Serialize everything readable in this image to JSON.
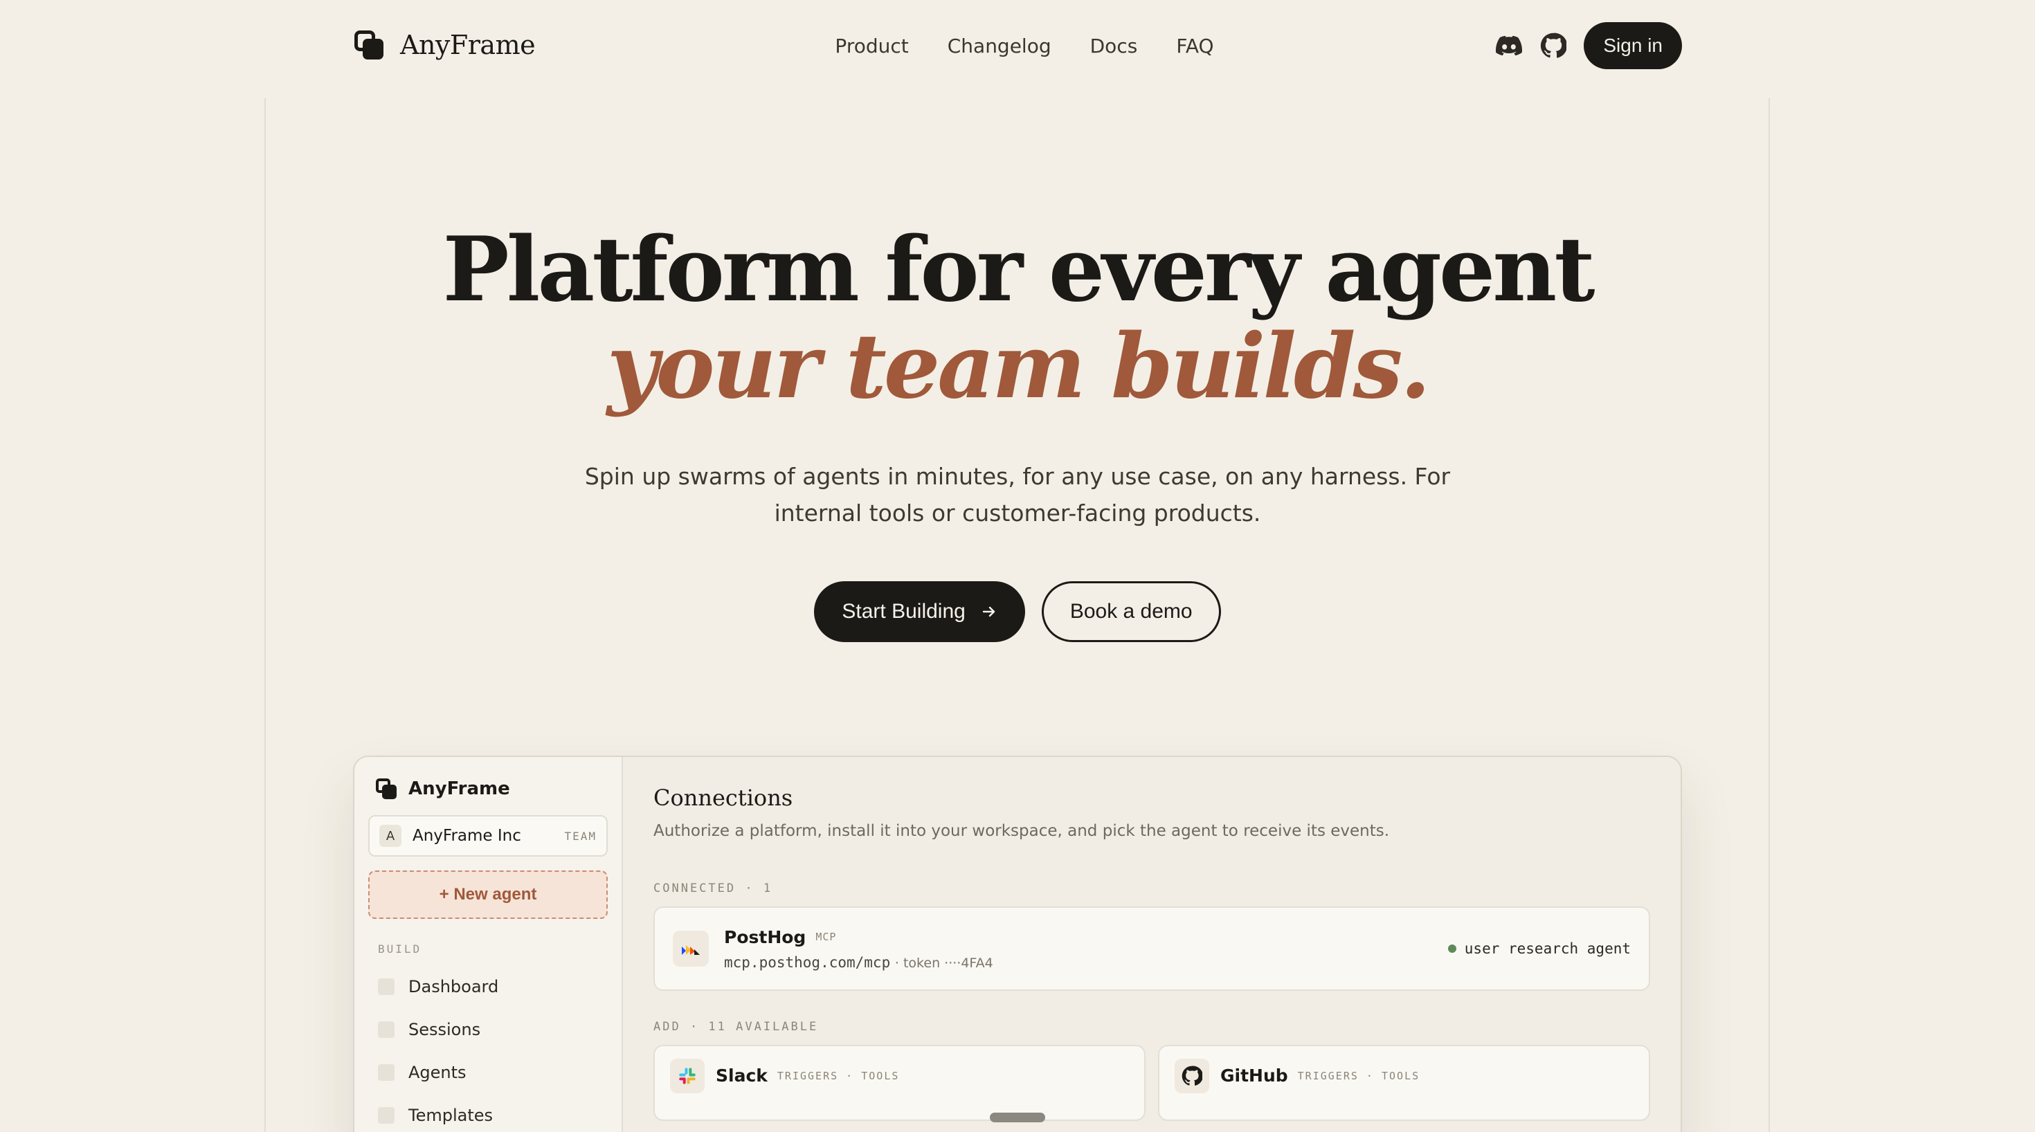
{
  "brand": {
    "name": "AnyFrame"
  },
  "nav": {
    "links": [
      "Product",
      "Changelog",
      "Docs",
      "FAQ"
    ],
    "icons": [
      "discord-icon",
      "github-icon"
    ],
    "signin_label": "Sign in"
  },
  "hero": {
    "title_line1": "Platform for every agent",
    "title_line2": "your team builds.",
    "subtitle": "Spin up swarms of agents in minutes, for any use case, on any harness. For internal tools or customer-facing products.",
    "primary_cta": "Start Building",
    "secondary_cta": "Book a demo"
  },
  "colors": {
    "accent": "#a0593a",
    "ink": "#1c1a17",
    "background": "#f3efe6",
    "status_green": "#5e8a5a"
  },
  "app": {
    "brand": "AnyFrame",
    "workspace": {
      "badge": "A",
      "name": "AnyFrame Inc",
      "tag": "TEAM"
    },
    "new_agent_label": "+ New agent",
    "section_build": "BUILD",
    "sidebar_items": [
      "Dashboard",
      "Sessions",
      "Agents",
      "Templates"
    ],
    "main": {
      "title": "Connections",
      "subtitle": "Authorize a platform, install it into your workspace, and pick the agent to receive its events.",
      "connected_label": "CONNECTED · 1",
      "connected": {
        "name": "PostHog",
        "tag": "MCP",
        "url": "mcp.posthog.com/mcp",
        "token": "· token ····4FA4",
        "agent": "user research agent"
      },
      "add_label": "ADD · 11 AVAILABLE",
      "available": [
        {
          "name": "Slack",
          "tags": "TRIGGERS · TOOLS"
        },
        {
          "name": "GitHub",
          "tags": "TRIGGERS · TOOLS"
        }
      ]
    }
  }
}
